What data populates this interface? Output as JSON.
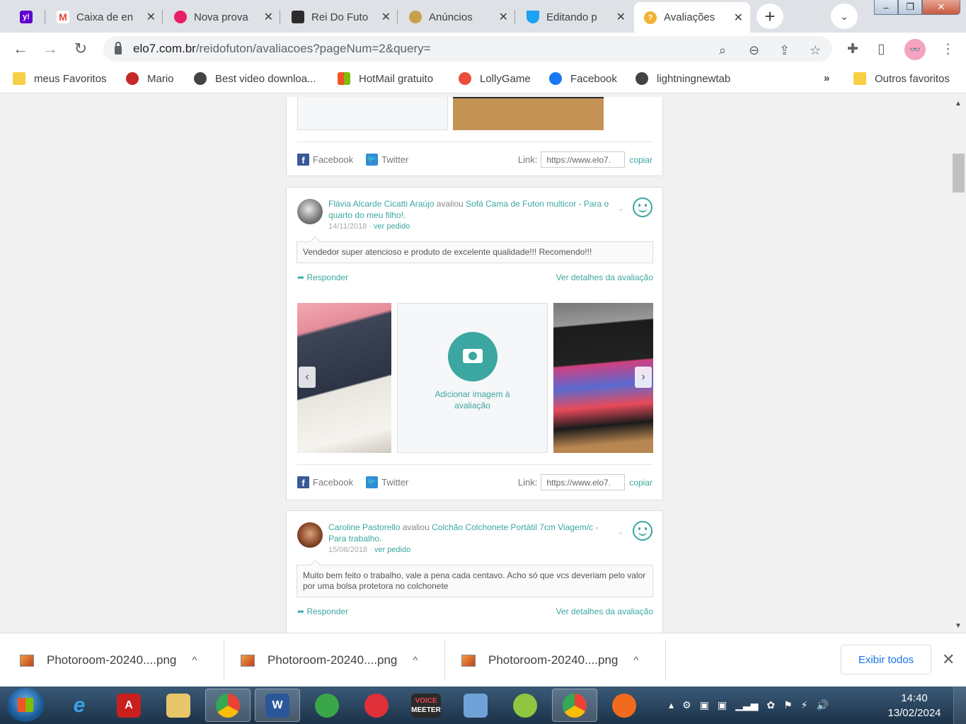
{
  "tabs": [
    {
      "title": "",
      "icon": "yahoo-icon",
      "color": "#6001d2"
    },
    {
      "title": "Caixa de en",
      "icon": "gmail-icon",
      "color": "#ea4335"
    },
    {
      "title": "Nova prova",
      "icon": "elo7-icon",
      "color": "#e91e63"
    },
    {
      "title": "Rei Do Futo",
      "icon": "store-icon",
      "color": "#2b2b2b"
    },
    {
      "title": "Anúncios",
      "icon": "ads-icon",
      "color": "#c9a04a"
    },
    {
      "title": "Editando p",
      "icon": "editor-icon",
      "color": "#1da1f2"
    },
    {
      "title": "Avaliações",
      "icon": "review-icon",
      "color": "#f2b233"
    }
  ],
  "address": {
    "host": "elo7.com.br",
    "path": "/reidofuton/avaliacoes?pageNum=2&query="
  },
  "bookmarks": [
    {
      "label": "meus Favoritos",
      "icon": "folder-icon"
    },
    {
      "label": "Mario",
      "icon": "mario-icon"
    },
    {
      "label": "Best video downloa...",
      "icon": "globe-icon"
    },
    {
      "label": "HotMail gratuito",
      "icon": "windows-icon"
    },
    {
      "label": "LollyGame",
      "icon": "lolly-icon"
    },
    {
      "label": "Facebook",
      "icon": "facebook-icon"
    },
    {
      "label": "lightningnewtab",
      "icon": "globe-icon"
    }
  ],
  "bookmarks_more": "»",
  "other_favorites": "Outros favoritos",
  "share": {
    "facebook": "Facebook",
    "twitter": "Twitter",
    "link_label": "Link:",
    "link_value": "https://www.elo7.",
    "copy": "copiar"
  },
  "reviews": [
    {
      "author": "Flávia Alcarde Cicatti Araújo",
      "verb": "avaliou",
      "product": "Sofá Cama de Futon multicor",
      "purpose": "- Para o quarto do meu filho!.",
      "date": "14/11/2018",
      "order_link": "ver pedido",
      "comment": "Vendedor super atencioso e produto de excelente qualidade!!! Recomendo!!!",
      "reply": "Responder",
      "details": "Ver detalhes da avaliação",
      "add_image": "Adicionar imagem à avaliação"
    },
    {
      "author": "Caroline Pastorello",
      "verb": "avaliou",
      "product": "Colchão Colchonete Portátil 7cm",
      "purpose": "Viagem/c - Para trabalho.",
      "date": "15/08/2018",
      "order_link": "ver pedido",
      "comment": "Muito bem feito o trabalho, vale a pena cada centavo. Acho só que vcs deveriam pelo valor por uma bolsa protetora no colchonete",
      "reply": "Responder",
      "details": "Ver detalhes da avaliação"
    }
  ],
  "downloads": [
    {
      "name": "Photoroom-20240....png"
    },
    {
      "name": "Photoroom-20240....png"
    },
    {
      "name": "Photoroom-20240....png"
    }
  ],
  "show_all": "Exibir todos",
  "taskbar": {
    "voicemeeter_top": "VOICE",
    "voicemeeter_bottom": "MEETER",
    "time": "14:40",
    "date": "13/02/2024"
  },
  "colors": {
    "accent": "#3ba7a0",
    "chrome_bg": "#dee1e6"
  }
}
